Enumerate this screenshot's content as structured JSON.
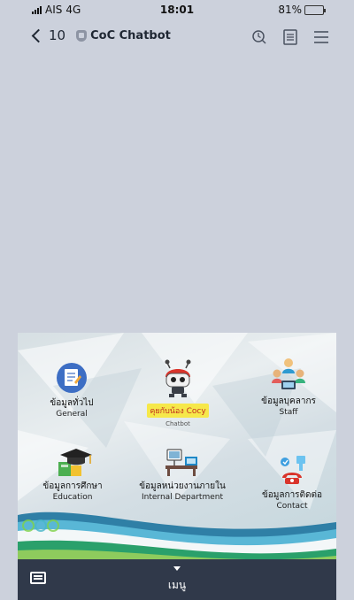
{
  "status": {
    "carrier": "AIS",
    "network": "4G",
    "time": "18:01",
    "battery": "81%"
  },
  "nav": {
    "back_count": "10",
    "title": "CoC Chatbot"
  },
  "richmenu": {
    "items": [
      {
        "th": "ข้อมูลทั่วไป",
        "en": "General"
      },
      {
        "th": "คุยกับน้อง Cocy",
        "en": "Chatbot"
      },
      {
        "th": "ข้อมูลบุคลากร",
        "en": "Staff"
      },
      {
        "th": "ข้อมูลการศึกษา",
        "en": "Education"
      },
      {
        "th": "ข้อมูลหน่วยงานภายใน",
        "en": "Internal Department"
      },
      {
        "th": "ข้อมูลการติดต่อ",
        "en": "Contact"
      }
    ]
  },
  "bottom": {
    "menu_label": "เมนู"
  }
}
